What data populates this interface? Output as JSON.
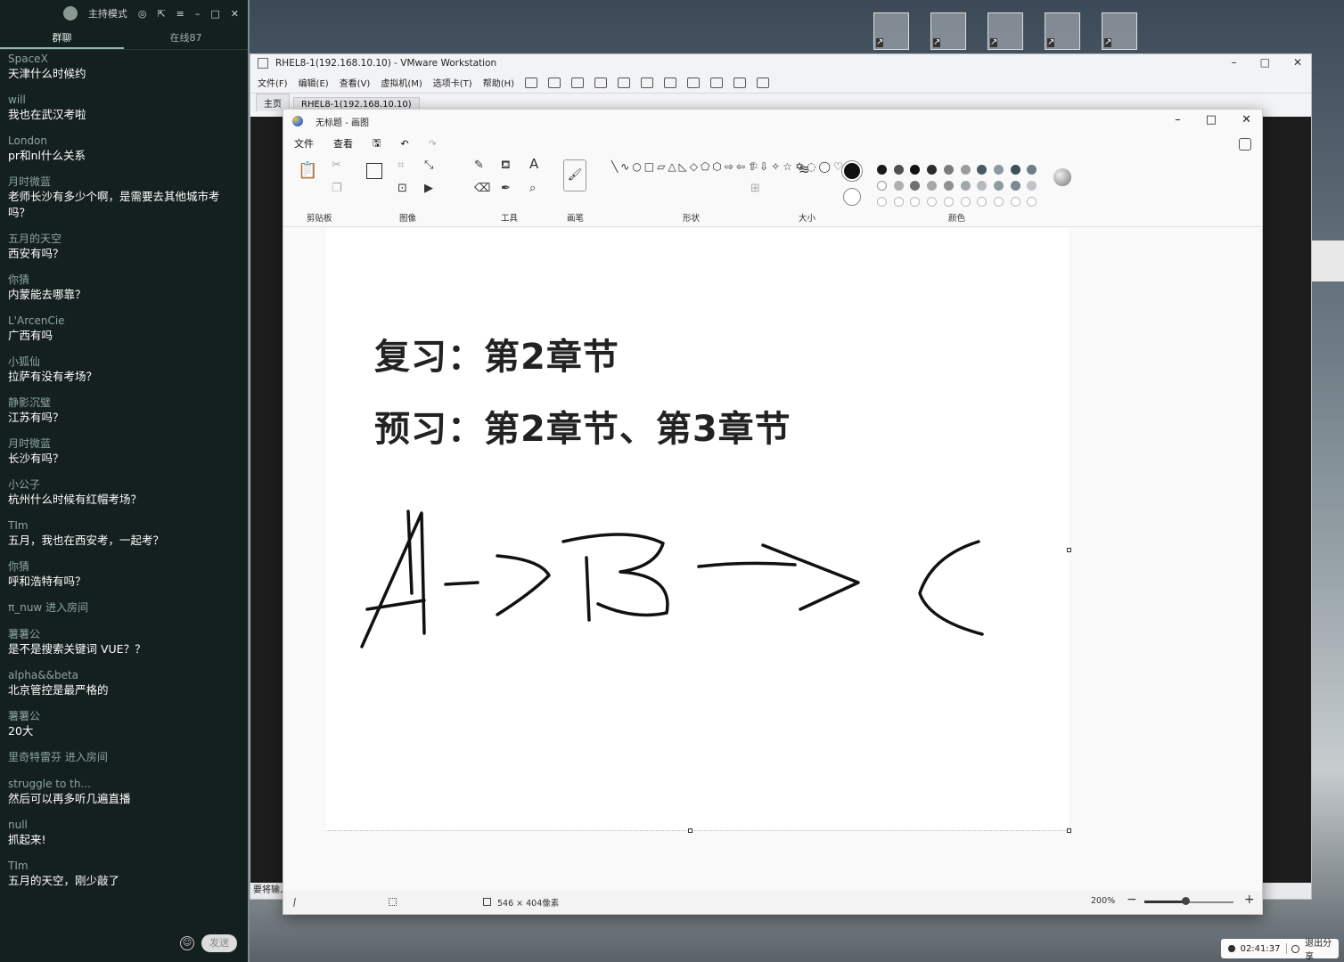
{
  "chat": {
    "header": {
      "mode": "主持模式"
    },
    "tabs": [
      "群聊",
      "在线87"
    ],
    "messages": [
      {
        "user": "SpaceX",
        "text": "天津什么时候约"
      },
      {
        "user": "will",
        "text": "我也在武汉考啦"
      },
      {
        "user": "London",
        "text": "pr和nl什么关系"
      },
      {
        "user": "月时微蓝",
        "text": "老师长沙有多少个啊，是需要去其他城市考吗？"
      },
      {
        "user": "五月的天空",
        "text": "西安有吗？"
      },
      {
        "user": "你猜",
        "text": "内蒙能去哪靠？"
      },
      {
        "user": "L'ArcenCie",
        "text": "广西有吗"
      },
      {
        "user": "小狐仙",
        "text": "拉萨有没有考场？"
      },
      {
        "user": "静影沉璧",
        "text": "江苏有吗？"
      },
      {
        "user": "月时微蓝",
        "text": "长沙有吗？"
      },
      {
        "user": "小公子",
        "text": "杭州什么时候有红帽考场？"
      },
      {
        "user": "TIm",
        "text": "五月，我也在西安考，一起考？"
      },
      {
        "user": "你猜",
        "text": "呼和浩特有吗？"
      }
    ],
    "system_1": "π_nuw 进入房间",
    "messages_2": [
      {
        "user": "薯薯公",
        "text": "是不是搜索关键词 VUE？？"
      },
      {
        "user": "alpha&&beta",
        "text": "北京管控是最严格的"
      },
      {
        "user": "薯薯公",
        "text": "20大"
      }
    ],
    "system_2": "里奇特雷芬 进入房间",
    "messages_3": [
      {
        "user": "struggle to th...",
        "text": "然后可以再多听几遍直播"
      },
      {
        "user": "null",
        "text": "抓起来!"
      },
      {
        "user": "TIm",
        "text": "五月的天空，刚少敲了"
      }
    ],
    "send_label": "发送"
  },
  "vmware": {
    "title": "RHEL8-1(192.168.10.10) - VMware Workstation",
    "menu": [
      "文件(F)",
      "编辑(E)",
      "查看(V)",
      "虚拟机(M)",
      "选项卡(T)",
      "帮助(H)"
    ],
    "tabs": [
      "主页",
      "RHEL8-1(192.168.10.10)"
    ],
    "status_text": "要将输入"
  },
  "paint": {
    "title": "无标题 - 画图",
    "menu": [
      "文件",
      "查看"
    ],
    "groups": [
      "剪贴板",
      "图像",
      "工具",
      "画笔",
      "形状",
      "大小",
      "颜色"
    ],
    "canvas_text": [
      "复习：第2章节",
      "预习：第2章节、第3章节"
    ],
    "size_readout": "546 × 404像素",
    "zoom": "200%",
    "zoom_level": 0.46,
    "colors": {
      "row1": [
        "#1a1a1a",
        "#505050",
        "#111111",
        "#2c2c2c",
        "#7a7a7a",
        "#9c9c9c",
        "#4a5a62",
        "#8a9aa0",
        "#3e5058",
        "#6c7e84"
      ],
      "row2": [
        "#ffffff",
        "#b0b0b0",
        "#707070",
        "#a8a8a8",
        "#909090",
        "#a0a8ac",
        "#b4bcc0",
        "#8e9a9e",
        "#7a8a90",
        "#c0c6c8"
      ]
    }
  },
  "recording": {
    "time": "02:41:37",
    "exit_label": "退出分享"
  }
}
